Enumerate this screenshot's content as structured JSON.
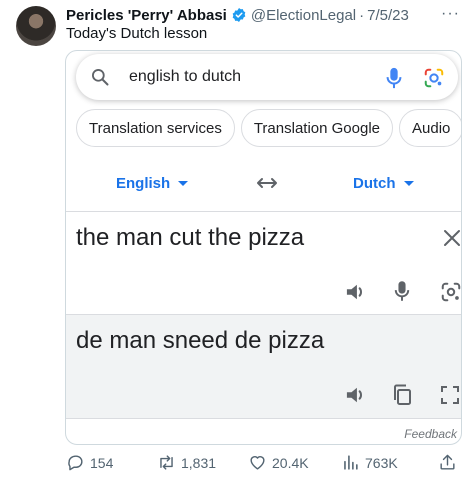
{
  "tweet": {
    "author_name": "Pericles 'Perry' Abbasi",
    "handle": "@ElectionLegal",
    "separator": "·",
    "date": "7/5/23",
    "more": "···",
    "text": "Today's Dutch lesson"
  },
  "google": {
    "search_query": "english to dutch",
    "chips": [
      "Translation services",
      "Translation Google",
      "Audio"
    ],
    "source_language": "English",
    "target_language": "Dutch",
    "source_text": "the man cut the pizza",
    "translated_text": "de man sneed de pizza",
    "feedback": "Feedback",
    "colors": {
      "accent": "#1a73e8",
      "mic_blue": "#4285f4",
      "lens_red": "#ea4335",
      "lens_yellow": "#fbbc04",
      "lens_green": "#34a853"
    }
  },
  "actions": {
    "replies": "154",
    "retweets": "1,831",
    "likes": "20.4K",
    "views": "763K"
  }
}
